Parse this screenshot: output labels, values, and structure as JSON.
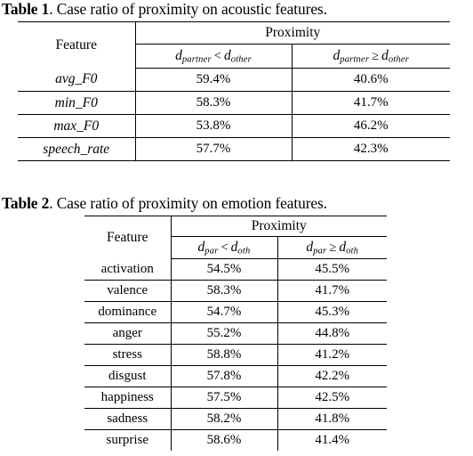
{
  "document": {
    "type": "academic-paper-tables"
  },
  "table1": {
    "caption_label": "Table 1",
    "caption_text": ". Case ratio of proximity on acoustic features.",
    "feature_header": "Feature",
    "group_header": "Proximity",
    "sub_headers": [
      {
        "var": "d",
        "sub1": "partner",
        "rel": "<",
        "var2": "d",
        "sub2": "other"
      },
      {
        "var": "d",
        "sub1": "partner",
        "rel": "≥",
        "var2": "d",
        "sub2": "other"
      }
    ],
    "rows": [
      {
        "feature": "avg_F0",
        "closer": "59.4%",
        "farther": "40.6%"
      },
      {
        "feature": "min_F0",
        "closer": "58.3%",
        "farther": "41.7%"
      },
      {
        "feature": "max_F0",
        "closer": "53.8%",
        "farther": "46.2%"
      },
      {
        "feature": "speech_rate",
        "closer": "57.7%",
        "farther": "42.3%"
      }
    ]
  },
  "table2": {
    "caption_label": "Table 2",
    "caption_text": ". Case ratio of proximity on emotion features.",
    "feature_header": "Feature",
    "group_header": "Proximity",
    "sub_headers": [
      {
        "var": "d",
        "sub1": "par",
        "rel": "<",
        "var2": "d",
        "sub2": "oth"
      },
      {
        "var": "d",
        "sub1": "par",
        "rel": "≥",
        "var2": "d",
        "sub2": "oth"
      }
    ],
    "rows": [
      {
        "feature": "activation",
        "closer": "54.5%",
        "farther": "45.5%"
      },
      {
        "feature": "valence",
        "closer": "58.3%",
        "farther": "41.7%"
      },
      {
        "feature": "dominance",
        "closer": "54.7%",
        "farther": "45.3%"
      },
      {
        "feature": "anger",
        "closer": "55.2%",
        "farther": "44.8%"
      },
      {
        "feature": "stress",
        "closer": "58.8%",
        "farther": "41.2%"
      },
      {
        "feature": "disgust",
        "closer": "57.8%",
        "farther": "42.2%"
      },
      {
        "feature": "happiness",
        "closer": "57.5%",
        "farther": "42.5%"
      },
      {
        "feature": "sadness",
        "closer": "58.2%",
        "farther": "41.8%"
      },
      {
        "feature": "surprise",
        "closer": "58.6%",
        "farther": "41.4%"
      }
    ]
  }
}
